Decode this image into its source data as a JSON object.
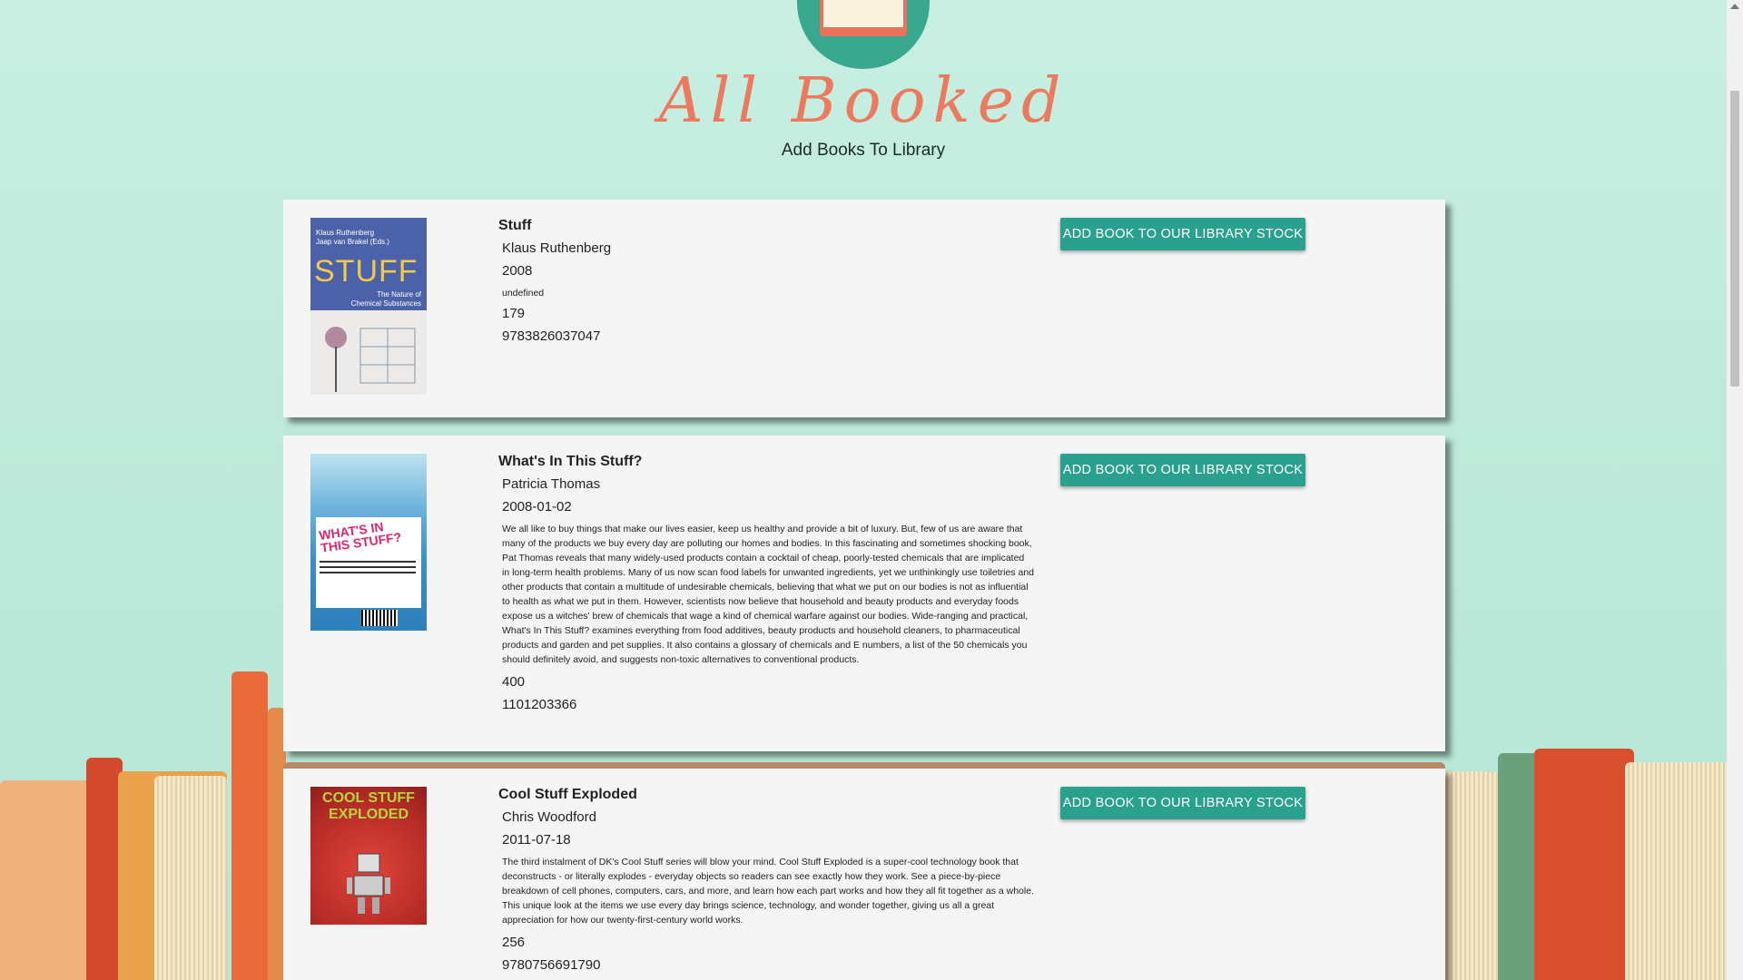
{
  "header": {
    "brand": "All Booked",
    "subtitle": "Add Books To Library"
  },
  "books": [
    {
      "title": "Stuff",
      "author": "Klaus Ruthenberg",
      "date": "2008",
      "description": "undefined",
      "pages": "179",
      "isbn": "9783826037047",
      "cover_text_top": "Klaus Ruthenberg\nJaap van Brakel (Eds.)",
      "cover_title": "STUFF",
      "cover_sub": "The Nature of\nChemical Substances",
      "button_label": "ADD BOOK TO OUR LIBRARY STOCK"
    },
    {
      "title": "What's In This Stuff?",
      "author": "Patricia Thomas",
      "date": "2008-01-02",
      "description": "We all like to buy things that make our lives easier, keep us healthy and provide a bit of luxury. But, few of us are aware that many of the products we buy every day are polluting our homes and bodies. In this fascinating and sometimes shocking book, Pat Thomas reveals that many widely-used products contain a cocktail of cheap, poorly-tested chemicals that are implicated in long-term health problems. Many of us now scan food labels for unwanted ingredients, yet we unthinkingly use toiletries and other products that contain a multitude of undesirable chemicals, believing that what we put on our bodies is not as influential to health as what we put in them. However, scientists now believe that household and beauty products and everyday foods expose us a witches' brew of chemicals that wage a kind of chemical warfare against our bodies. Wide-ranging and practical, What's In This Stuff? examines everything from food additives, beauty products and household cleaners, to pharmaceutical products and garden and pet supplies. It also contains a glossary of chemicals and E numbers, a list of the 50 chemicals you should definitely avoid, and suggests non-toxic alternatives to conventional products.",
      "pages": "400",
      "isbn": "1101203366",
      "cover_title": "WHAT'S IN THIS STUFF?",
      "button_label": "ADD BOOK TO OUR LIBRARY STOCK"
    },
    {
      "title": "Cool Stuff Exploded",
      "author": "Chris Woodford",
      "date": "2011-07-18",
      "description": "The third instalment of DK's Cool Stuff series will blow your mind. Cool Stuff Exploded is a super-cool technology book that deconstructs - or literally explodes - everyday objects so readers can see exactly how they work. See a piece-by-piece breakdown of cell phones, computers, cars, and more, and learn how each part works and how they all fit together as a whole. This unique look at the items we use every day brings science, technology, and wonder together, giving us all a great appreciation for how our twenty-first-century world works.",
      "pages": "256",
      "isbn": "9780756691790",
      "cover_title": "COOL STUFF EXPLODED",
      "button_label": "ADD BOOK TO OUR LIBRARY STOCK"
    }
  ],
  "colors": {
    "accent": "#2aa18e",
    "brand": "#ec7a5f",
    "card_bg": "#f5f5f5"
  }
}
